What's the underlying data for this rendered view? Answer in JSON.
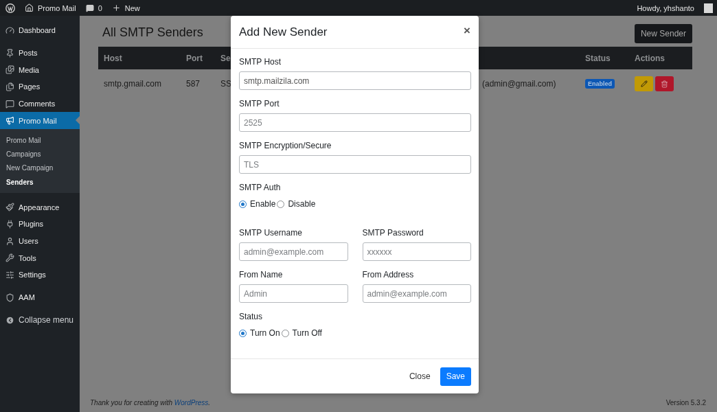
{
  "admin_bar": {
    "site": "Promo Mail",
    "comments": "0",
    "new": "New",
    "greeting": "Howdy, yhshanto"
  },
  "sidebar": {
    "groups": [
      {
        "items": [
          {
            "label": "Dashboard",
            "selected": false
          }
        ]
      },
      {
        "items": [
          {
            "label": "Posts",
            "selected": false
          },
          {
            "label": "Media",
            "selected": false
          },
          {
            "label": "Pages",
            "selected": false
          },
          {
            "label": "Comments",
            "selected": false
          },
          {
            "label": "Promo Mail",
            "selected": true,
            "children": [
              {
                "label": "Promo Mail",
                "selected": false
              },
              {
                "label": "Campaigns",
                "selected": false
              },
              {
                "label": "New Campaign",
                "selected": false
              },
              {
                "label": "Senders",
                "selected": true
              }
            ]
          }
        ]
      },
      {
        "items": [
          {
            "label": "Appearance",
            "selected": false
          },
          {
            "label": "Plugins",
            "selected": false
          },
          {
            "label": "Users",
            "selected": false
          },
          {
            "label": "Tools",
            "selected": false
          },
          {
            "label": "Settings",
            "selected": false
          }
        ]
      },
      {
        "items": [
          {
            "label": "AAM",
            "selected": false
          }
        ]
      }
    ],
    "collapse": "Collapse menu"
  },
  "page": {
    "title": "All SMTP Senders",
    "new_button": "New Sender"
  },
  "table": {
    "columns": [
      "Host",
      "Port",
      "Se",
      "",
      "Status",
      "Actions"
    ],
    "rows": [
      {
        "host": "smtp.gmail.com",
        "port": "587",
        "column_3": "SS",
        "column_4": "(admin@gmail.com)",
        "status": "Enabled"
      }
    ]
  },
  "modal": {
    "title": "Add New Sender",
    "close": "×",
    "rows": [
      {
        "fields": [
          {
            "kind": "text",
            "label": "SMTP Host",
            "value": "smtp.mailzila.com"
          }
        ]
      },
      {
        "fields": [
          {
            "kind": "text",
            "label": "SMTP Port",
            "placeholder": "2525"
          }
        ]
      },
      {
        "fields": [
          {
            "kind": "text",
            "label": "SMTP Encryption/Secure",
            "placeholder": "TLS"
          }
        ]
      },
      {
        "fields": [
          {
            "kind": "radio",
            "label": "SMTP Auth",
            "options": [
              {
                "label": "Enable",
                "selected": true
              },
              {
                "label": "Disable",
                "selected": false
              }
            ]
          }
        ]
      },
      {
        "fields": [
          {
            "kind": "text",
            "label": "SMTP Username",
            "placeholder": "admin@example.com"
          },
          {
            "kind": "text",
            "label": "SMTP Password",
            "placeholder": "xxxxxx"
          }
        ]
      },
      {
        "fields": [
          {
            "kind": "text",
            "label": "From Name",
            "placeholder": "Admin"
          },
          {
            "kind": "text",
            "label": "From Address",
            "placeholder": "admin@example.com"
          }
        ]
      },
      {
        "fields": [
          {
            "kind": "radio",
            "label": "Status",
            "options": [
              {
                "label": "Turn On",
                "selected": true
              },
              {
                "label": "Turn Off",
                "selected": false
              }
            ]
          }
        ]
      }
    ],
    "buttons": {
      "close": "Close",
      "save": "Save"
    }
  },
  "footer": {
    "text_before": "Thank you for creating with ",
    "link": "WordPress",
    "text_after": ".",
    "version": "Version 5.3.2"
  }
}
